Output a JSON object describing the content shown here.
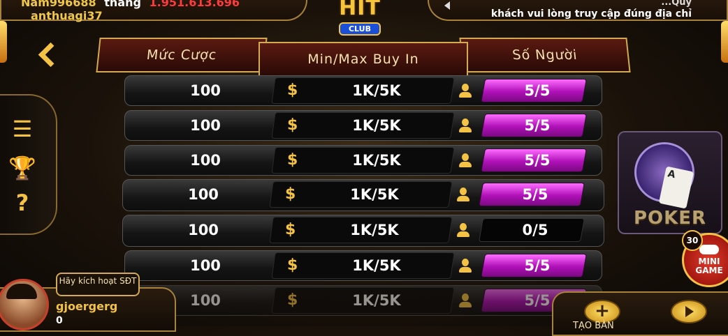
{
  "ticker": {
    "user": "Nam996688",
    "verb": "thắng",
    "amount": "1.951.613.696",
    "user2": "anthuagi37"
  },
  "notice": {
    "line1": "...Quý",
    "line2": "khách vui lòng truy cập đúng địa chỉ"
  },
  "logo": {
    "main": "HIT",
    "sub": "CLUB"
  },
  "headers": {
    "bet": "Mức Cược",
    "buyin": "Min/Max Buy In",
    "players": "Số Người"
  },
  "rows": [
    {
      "bet": "100",
      "buyin": "1K/5K",
      "seats": "5/5",
      "full": true
    },
    {
      "bet": "100",
      "buyin": "1K/5K",
      "seats": "5/5",
      "full": true
    },
    {
      "bet": "100",
      "buyin": "1K/5K",
      "seats": "5/5",
      "full": true
    },
    {
      "bet": "100",
      "buyin": "1K/5K",
      "seats": "5/5",
      "full": true
    },
    {
      "bet": "100",
      "buyin": "1K/5K",
      "seats": "0/5",
      "full": false
    },
    {
      "bet": "100",
      "buyin": "1K/5K",
      "seats": "5/5",
      "full": true
    },
    {
      "bet": "100",
      "buyin": "1K/5K",
      "seats": "5/5",
      "full": true
    }
  ],
  "currency_symbol": "$",
  "poker": {
    "label": "POKER"
  },
  "minigame": {
    "badge": "30",
    "label1": "MINI",
    "label2": "GAME"
  },
  "user": {
    "activate": "Hãy kích hoạt SĐT",
    "name": "gjoergerg",
    "balance": "0"
  },
  "bottom": {
    "create_label": "TẠO BÀN"
  }
}
